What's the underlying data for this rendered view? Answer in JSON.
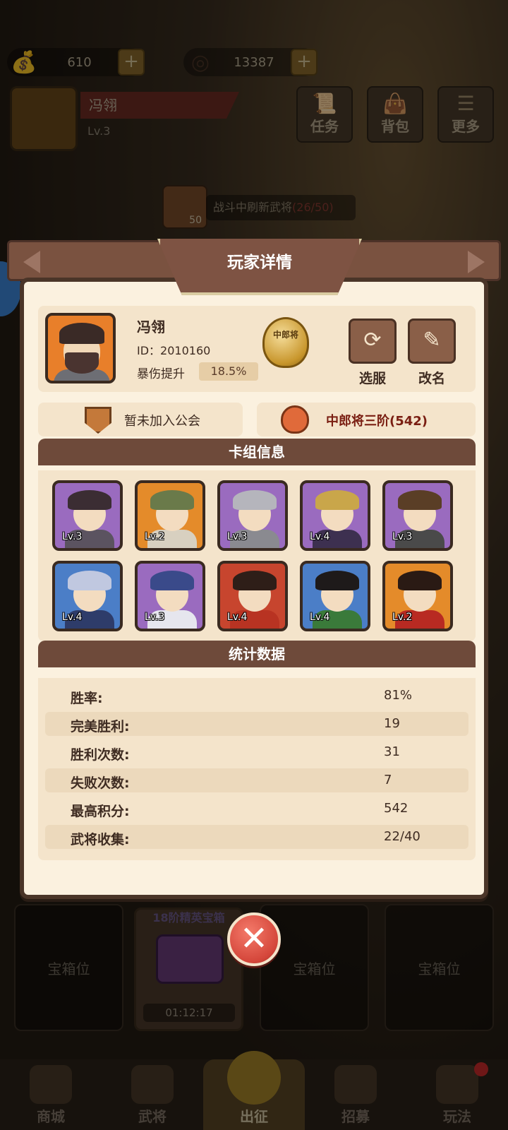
{
  "resources": {
    "gold": "610",
    "coins": "13387"
  },
  "player_bar": {
    "name": "冯翎",
    "level": "Lv.3"
  },
  "top_buttons": [
    {
      "label": "任务",
      "icon": "scroll-icon"
    },
    {
      "label": "背包",
      "icon": "bag-icon"
    },
    {
      "label": "更多",
      "icon": "menu-icon"
    }
  ],
  "refresh": {
    "count": "50",
    "text": "战斗中刷新武将",
    "progress": "(26/50)"
  },
  "modal": {
    "title": "玩家详情",
    "profile": {
      "name": "冯翎",
      "id": "ID：2010160",
      "crit_label": "暴伤提升",
      "crit_value": "18.5%",
      "rank_badge": "中郎将",
      "server_button": "选服",
      "rename_button": "改名"
    },
    "guild_text": "暂未加入公会",
    "rank_text": "中郎将三阶(542)",
    "deck": {
      "title": "卡组信息",
      "heroes": [
        {
          "level": "Lv.3",
          "rarity": "purple"
        },
        {
          "level": "Lv.2",
          "rarity": "orange"
        },
        {
          "level": "Lv.3",
          "rarity": "purple"
        },
        {
          "level": "Lv.4",
          "rarity": "purple"
        },
        {
          "level": "Lv.3",
          "rarity": "purple"
        },
        {
          "level": "Lv.4",
          "rarity": "blue"
        },
        {
          "level": "Lv.3",
          "rarity": "purple"
        },
        {
          "level": "Lv.4",
          "rarity": "blue"
        },
        {
          "level": "Lv.4",
          "rarity": "blue"
        },
        {
          "level": "Lv.2",
          "rarity": "orange"
        }
      ]
    },
    "stats": {
      "title": "统计数据",
      "rows": [
        {
          "label": "胜率:",
          "value": "81%"
        },
        {
          "label": "完美胜利:",
          "value": "19"
        },
        {
          "label": "胜利次数:",
          "value": "31"
        },
        {
          "label": "失败次数:",
          "value": "7"
        },
        {
          "label": "最高积分:",
          "value": "542"
        },
        {
          "label": "武将收集:",
          "value": "22/40"
        }
      ]
    }
  },
  "chests": {
    "slot_label": "宝箱位",
    "elite_title": "18阶精英宝箱",
    "elite_timer": "01:12:17"
  },
  "bottom_nav": [
    {
      "label": "商城"
    },
    {
      "label": "武将"
    },
    {
      "label": "出征"
    },
    {
      "label": "招募"
    },
    {
      "label": "玩法"
    }
  ],
  "colors": {
    "modal_bg": "#fbf1df",
    "header_brown": "#6e4a3a",
    "close_red": "#d4463a"
  }
}
